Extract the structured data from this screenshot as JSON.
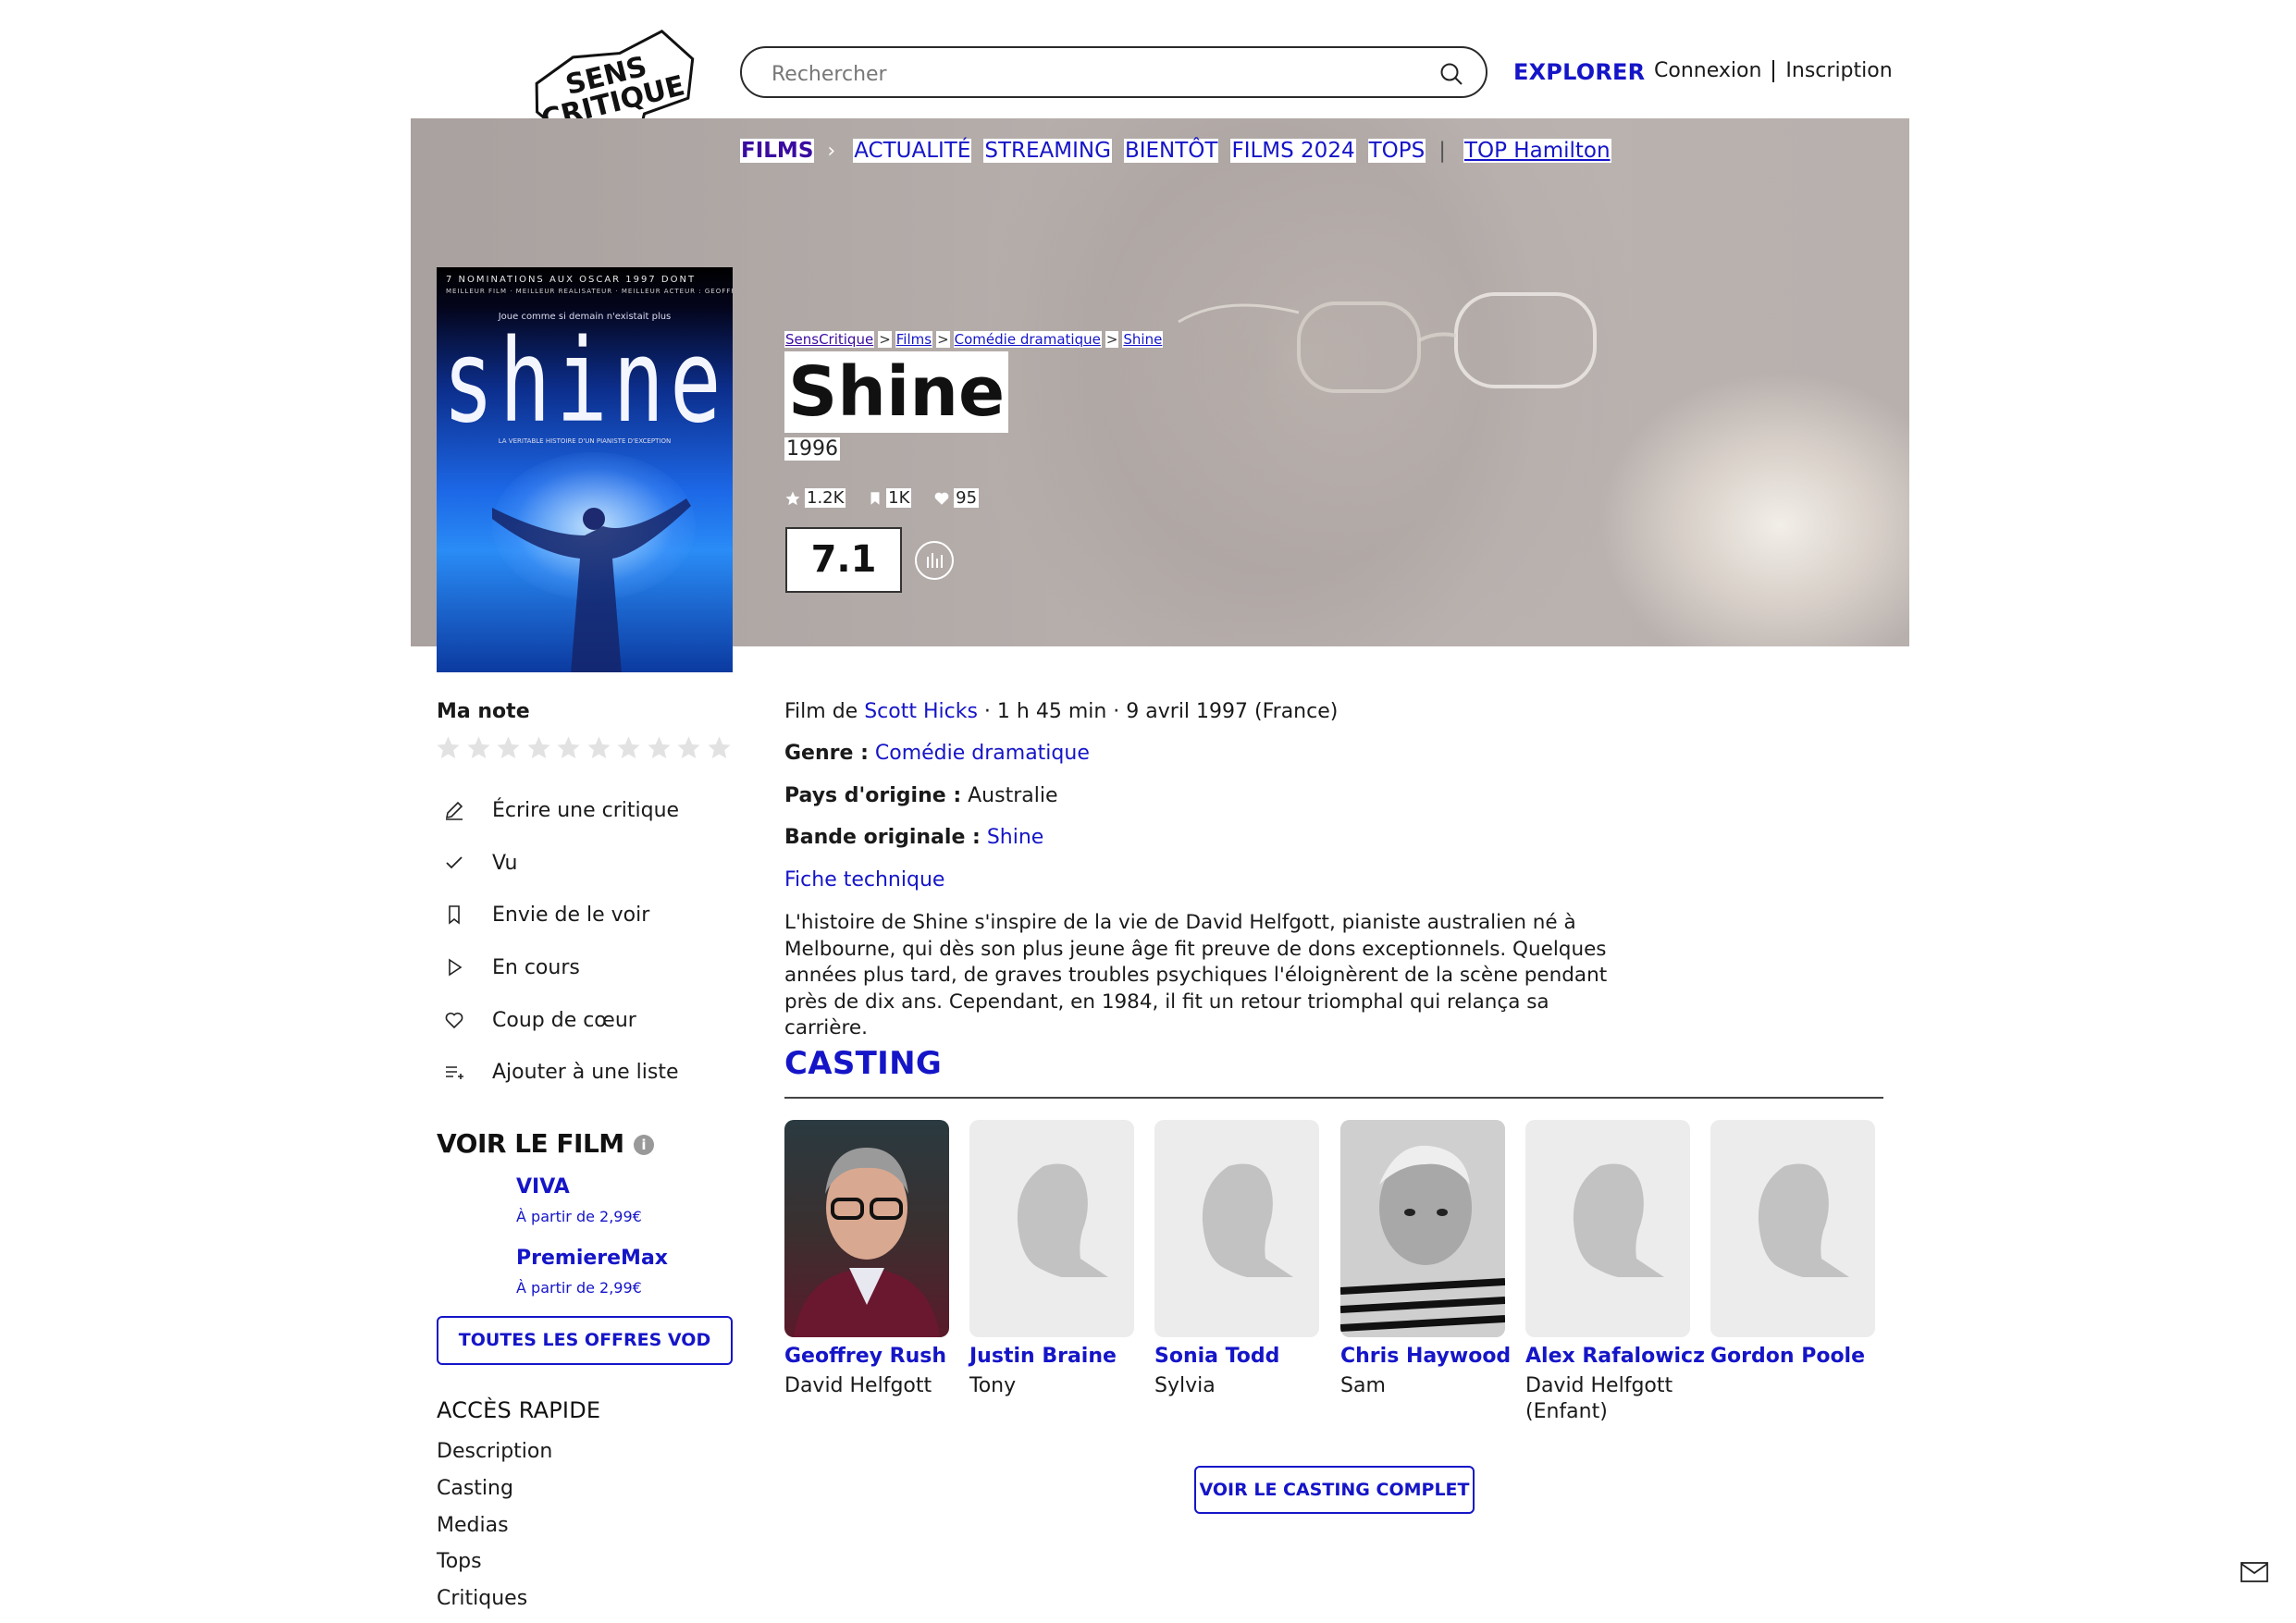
{
  "header": {
    "logo_text_line1": "SENS",
    "logo_text_line2": "CRITIQUE",
    "search_placeholder": "Rechercher",
    "explorer": "EXPLORER",
    "connexion": "Connexion",
    "inscription": "Inscription"
  },
  "nav": {
    "items": [
      "FILMS",
      "ACTUALITÉ",
      "STREAMING",
      "BIENTÔT",
      "FILMS 2024",
      "TOPS",
      "TOP Hamilton"
    ]
  },
  "breadcrumb": [
    "SensCritique",
    "Films",
    "Comédie dramatique",
    "Shine"
  ],
  "film": {
    "title": "Shine",
    "year": "1996",
    "stats": {
      "ratings": "1.2K",
      "wishlist": "1K",
      "favorites": "95"
    },
    "score": "7.1",
    "director_prefix": "Film de",
    "director": "Scott Hicks",
    "meta": "· 1 h 45 min · 9 avril 1997 (France)",
    "genre_label": "Genre :",
    "genre": "Comédie dramatique",
    "country_label": "Pays d'origine :",
    "country": "Australie",
    "soundtrack_label": "Bande originale :",
    "soundtrack": "Shine",
    "tech_sheet": "Fiche technique",
    "synopsis": "L'histoire de Shine s'inspire de la vie de David Helfgott, pianiste australien né à Melbourne, qui dès son plus jeune âge fit preuve de dons exceptionnels. Quelques années plus tard, de graves troubles psychiques l'éloignèrent de la scène pendant près de dix ans. Cependant, en 1984, il fit un retour triomphal qui relança sa carrière."
  },
  "poster": {
    "top_line": "7 NOMINATIONS AUX OSCAR 1997 DONT",
    "sub_line": "MEILLEUR FILM · MEILLEUR REALISATEUR · MEILLEUR ACTEUR : GEOFFREY RUSH",
    "tagline": "Joue comme si demain n'existait plus",
    "title": "shine",
    "bottom_line": "LA VERITABLE HISTOIRE D'UN PIANISTE D'EXCEPTION"
  },
  "sidebar": {
    "my_rating": "Ma note",
    "star_count": 10,
    "actions": [
      {
        "label": "Écrire une critique",
        "icon": "pencil-icon"
      },
      {
        "label": "Vu",
        "icon": "check-icon"
      },
      {
        "label": "Envie de le voir",
        "icon": "bookmark-icon"
      },
      {
        "label": "En cours",
        "icon": "play-icon"
      },
      {
        "label": "Coup de cœur",
        "icon": "heart-icon"
      },
      {
        "label": "Ajouter à une liste",
        "icon": "add-list-icon"
      }
    ],
    "watch_title": "VOIR LE FILM",
    "offers": [
      {
        "name": "VIVA",
        "price": "À partir de 2,99€"
      },
      {
        "name": "PremiereMax",
        "price": "À partir de 2,99€"
      }
    ],
    "all_offers": "TOUTES LES OFFRES VOD",
    "quick_title": "ACCÈS RAPIDE",
    "quick_links": [
      "Description",
      "Casting",
      "Medias",
      "Tops",
      "Critiques"
    ]
  },
  "casting": {
    "title": "CASTING",
    "members": [
      {
        "name": "Geoffrey Rush",
        "role": "David Helfgott"
      },
      {
        "name": "Justin Braine",
        "role": "Tony"
      },
      {
        "name": "Sonia Todd",
        "role": "Sylvia"
      },
      {
        "name": "Chris Haywood",
        "role": "Sam"
      },
      {
        "name": "Alex Rafalowicz",
        "role": "David Helfgott (Enfant)"
      },
      {
        "name": "Gordon Poole",
        "role": ""
      }
    ],
    "full_button": "VOIR LE CASTING COMPLET"
  },
  "colors": {
    "accent": "#1515c8",
    "films_nav": "#3a0ca0",
    "text": "#1a1a1a"
  }
}
